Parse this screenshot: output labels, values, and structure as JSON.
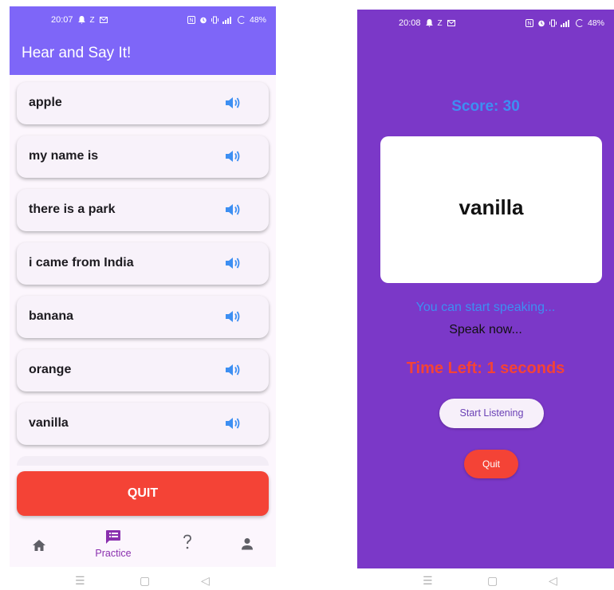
{
  "left": {
    "status_time": "20:07",
    "status_icons": [
      "bell-icon",
      "z-icon",
      "mail-icon"
    ],
    "status_right_icons": [
      "nfc-icon",
      "alarm-icon",
      "vibrate-icon",
      "signal-icon"
    ],
    "battery": "48%",
    "app_title": "Hear and Say It!",
    "items": [
      {
        "label": "apple"
      },
      {
        "label": "my name is"
      },
      {
        "label": "there is a park"
      },
      {
        "label": "i came from India"
      },
      {
        "label": "banana"
      },
      {
        "label": "orange"
      },
      {
        "label": "vanilla"
      }
    ],
    "quit_label": "QUIT",
    "nav": [
      {
        "icon": "home-icon",
        "label": ""
      },
      {
        "icon": "practice-icon",
        "label": "Practice",
        "active": true
      },
      {
        "icon": "help-icon",
        "label": ""
      },
      {
        "icon": "person-icon",
        "label": ""
      }
    ],
    "accent": "#7e66f8",
    "quit_color": "#f44336",
    "speaker_color": "#3d8ff2"
  },
  "right": {
    "status_time": "20:08",
    "status_icons": [
      "bell-icon",
      "z-icon",
      "mail-icon"
    ],
    "status_right_icons": [
      "nfc-icon",
      "alarm-icon",
      "vibrate-icon",
      "signal-icon"
    ],
    "battery": "48%",
    "score": "Score: 30",
    "word": "vanilla",
    "status_primary": "You can start speaking...",
    "status_secondary": "Speak now...",
    "time_left": "Time Left: 1 seconds",
    "listen_label": "Start Listening",
    "quit_label": "Quit",
    "background": "#7b38c8"
  },
  "sysnav": {
    "menu_glyph": "☰",
    "home_glyph": "▢",
    "back_glyph": "◁"
  }
}
